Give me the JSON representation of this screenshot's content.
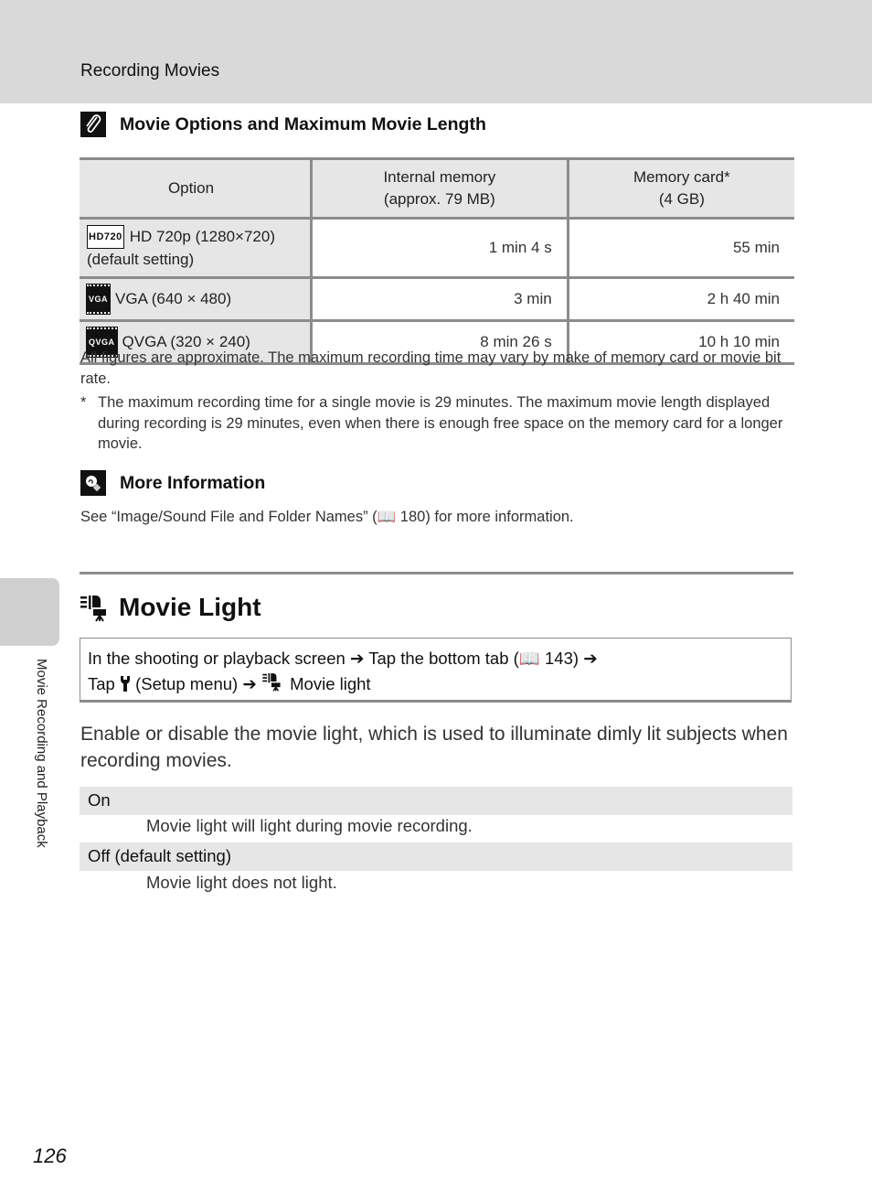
{
  "header": {
    "title": "Recording Movies"
  },
  "side_tab": {
    "label": "Movie Recording and Playback"
  },
  "note": {
    "icon": "paperclip-note-icon",
    "title": "Movie Options and Maximum Movie Length",
    "table": {
      "headers": [
        "Option",
        "Internal memory",
        "(approx. 79 MB)",
        "Memory card*",
        "(4 GB)"
      ],
      "rows": [
        {
          "icon": "hd-720-icon",
          "icon_text": "HD720",
          "option": "HD 720p (1280×720)",
          "option_sub": "(default setting)",
          "internal": "1 min 4 s",
          "card": "55 min"
        },
        {
          "icon": "vga-film-icon",
          "icon_text": "VGA",
          "option": "VGA (640 × 480)",
          "option_sub": "",
          "internal": "3 min",
          "card": "2 h 40 min"
        },
        {
          "icon": "qvga-film-icon",
          "icon_text": "QVGA",
          "option": "QVGA (320 × 240)",
          "option_sub": "",
          "internal": "8 min 26 s",
          "card": "10 h 10 min"
        }
      ]
    },
    "footnote_general": "All figures are approximate. The maximum recording time may vary by make of memory card or movie bit rate.",
    "footnote_star_mark": "*",
    "footnote_star": "The maximum recording time for a single movie is 29 minutes. The maximum movie length displayed during recording is 29 minutes, even when there is enough free space on the memory card for a longer movie."
  },
  "more_info": {
    "icon": "lightbulb-info-icon",
    "title": "More Information",
    "text_before": "See “Image/Sound File and Folder Names” (",
    "page_ref": "180",
    "text_after": ") for more information."
  },
  "section": {
    "icon": "movie-light-icon",
    "title": "Movie Light",
    "nav": {
      "line1_a": "In the shooting or playback screen",
      "line1_b": "Tap the bottom tab (",
      "line1_ref": "143",
      "line1_c": ")",
      "line2_a": "Tap",
      "line2_b": "(Setup menu)",
      "line2_c": "Movie light",
      "arrow": "➔"
    },
    "intro": "Enable or disable the movie light, which is used to illuminate dimly lit subjects when recording movies.",
    "options": [
      {
        "label": "On",
        "desc": "Movie light will light during movie recording."
      },
      {
        "label": "Off (default setting)",
        "desc": "Movie light does not light."
      }
    ]
  },
  "page_number": "126"
}
